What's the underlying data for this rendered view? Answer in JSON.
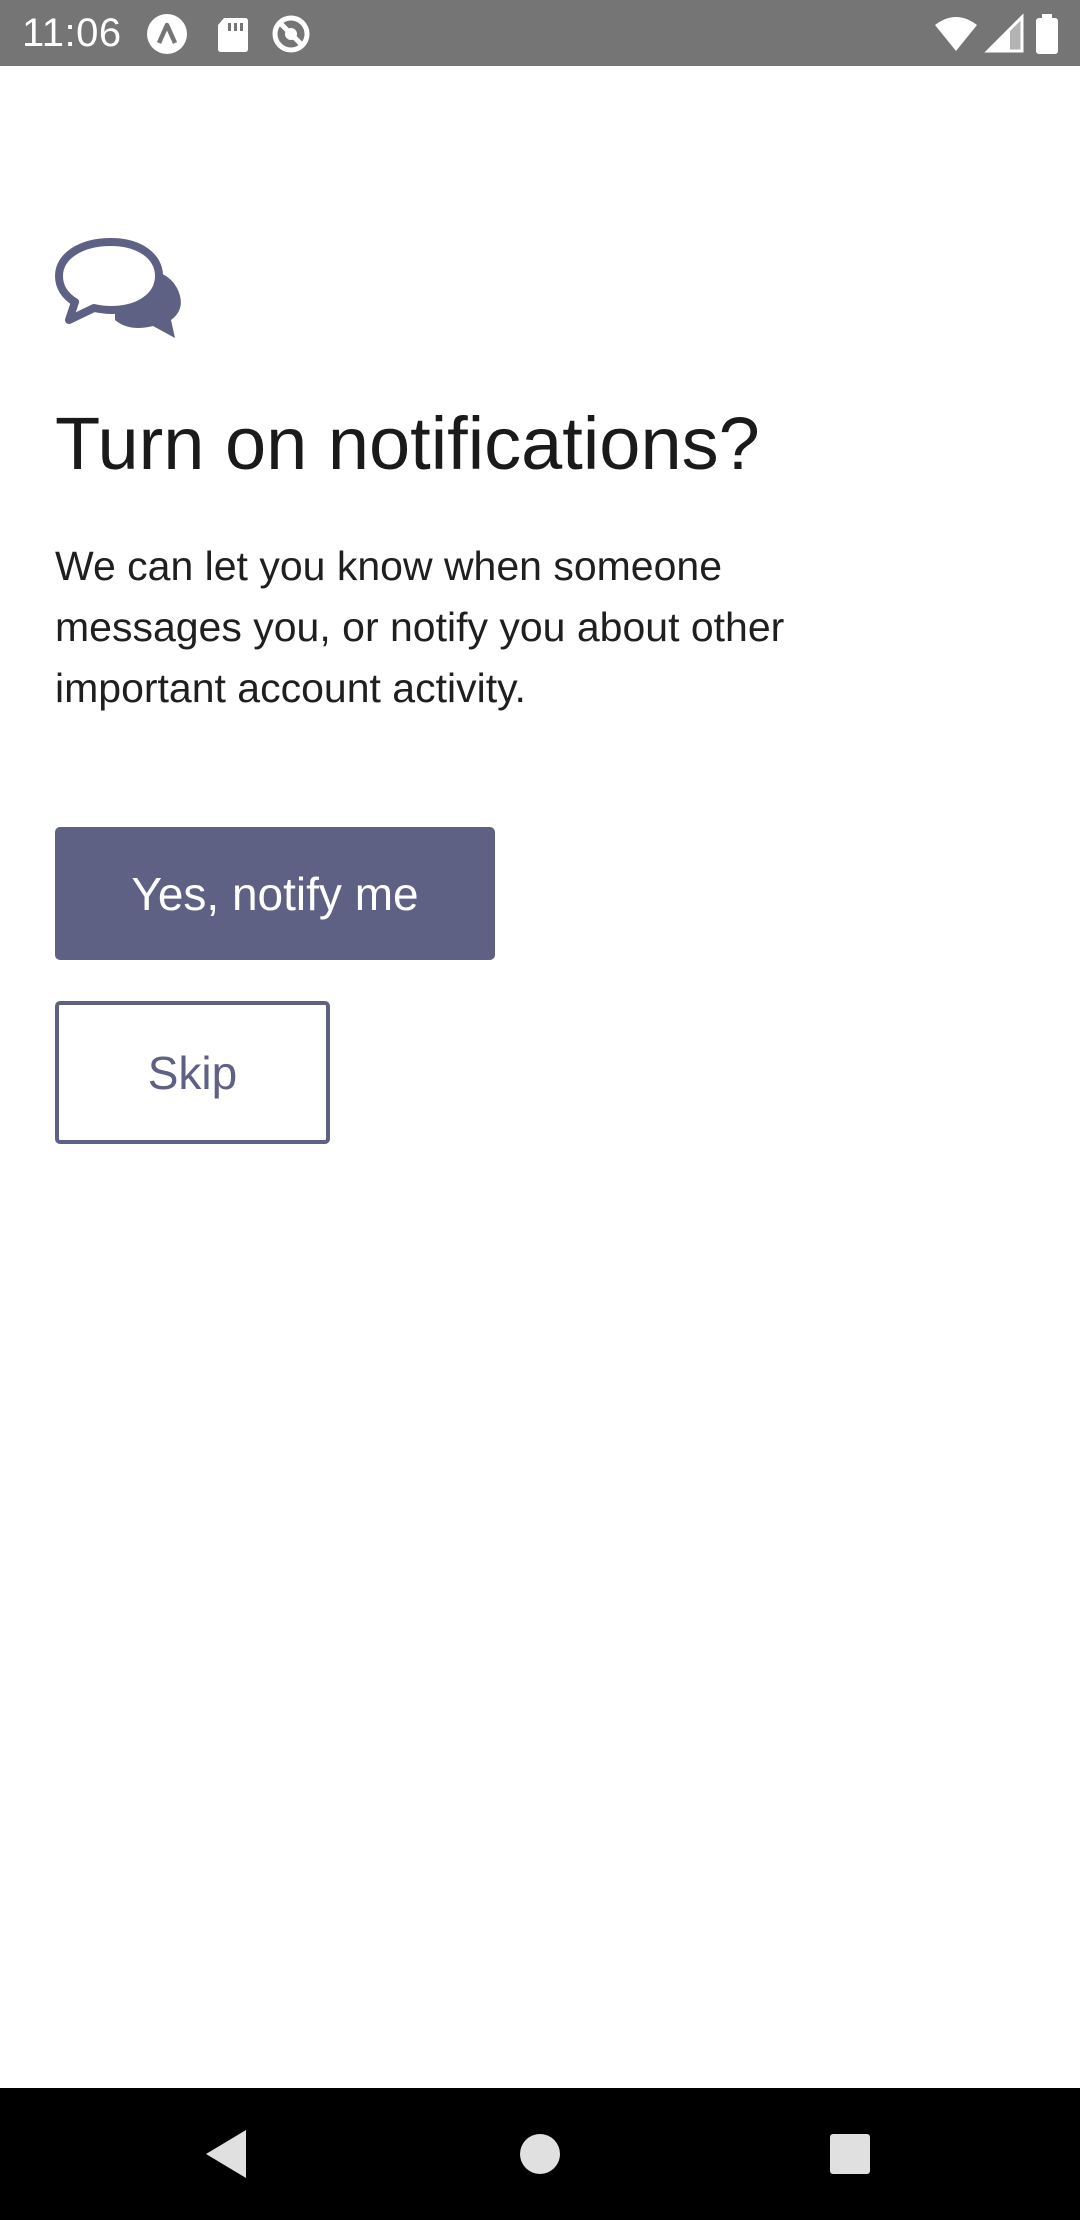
{
  "status_bar": {
    "time": "11:06",
    "icons": [
      "app-a-icon",
      "sd-card-icon",
      "no-sync-icon",
      "wifi-icon",
      "cellular-signal-icon",
      "battery-icon"
    ]
  },
  "onboarding": {
    "icon": "chat-bubbles-icon",
    "title": "Turn on notifications?",
    "body": "We can let you know when someone messages you, or notify you about other important account activity.",
    "primary_button": "Yes, notify me",
    "secondary_button": "Skip"
  },
  "nav_bar": {
    "buttons": [
      "back-icon",
      "home-icon",
      "recents-icon"
    ]
  },
  "colors": {
    "accent": "#5e6184",
    "status_bar": "#757575",
    "nav_bar": "#000000",
    "background": "#ffffff"
  }
}
